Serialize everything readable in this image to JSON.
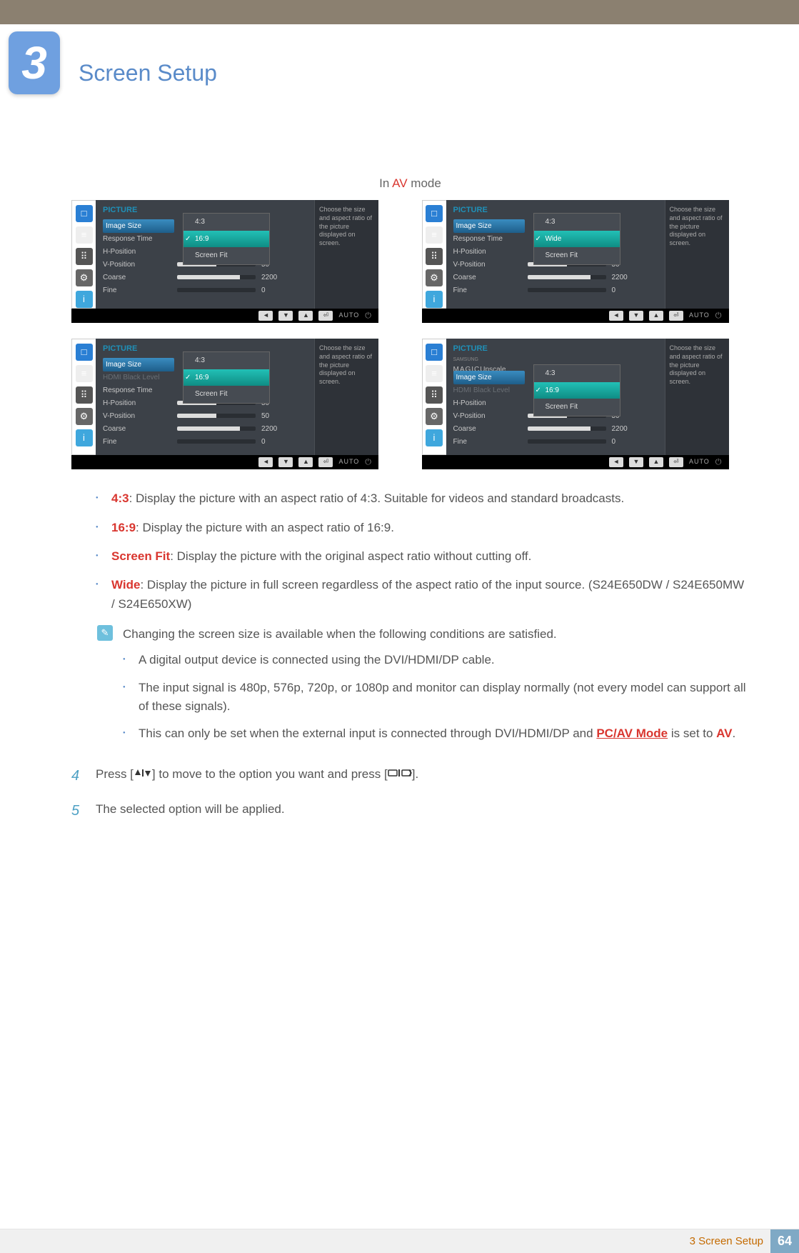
{
  "header": {
    "chapter": "3",
    "title": "Screen Setup"
  },
  "mode_label": {
    "prefix": "In ",
    "highlight": "AV",
    "suffix": " mode"
  },
  "osd": {
    "title": "PICTURE",
    "help": "Choose the size and aspect ratio of the picture displayed on screen.",
    "auto": "AUTO",
    "panels": [
      {
        "rows": [
          {
            "label": "Image Size",
            "selected": true
          },
          {
            "label": "Response Time"
          },
          {
            "label": "H-Position"
          },
          {
            "label": "V-Position",
            "value": "50",
            "fill": 50
          },
          {
            "label": "Coarse",
            "value": "2200",
            "fill": 80
          },
          {
            "label": "Fine",
            "value": "0",
            "fill": 0
          }
        ],
        "options": [
          {
            "label": "4:3"
          },
          {
            "label": "16:9",
            "checked": true,
            "selected": true
          },
          {
            "label": "Screen Fit"
          }
        ]
      },
      {
        "rows": [
          {
            "label": "Image Size",
            "selected": true
          },
          {
            "label": "Response Time"
          },
          {
            "label": "H-Position"
          },
          {
            "label": "V-Position",
            "value": "50",
            "fill": 50
          },
          {
            "label": "Coarse",
            "value": "2200",
            "fill": 80
          },
          {
            "label": "Fine",
            "value": "0",
            "fill": 0
          }
        ],
        "options": [
          {
            "label": "4:3"
          },
          {
            "label": "Wide",
            "checked": true,
            "selected": true
          },
          {
            "label": "Screen Fit"
          }
        ]
      },
      {
        "rows": [
          {
            "label": "Image Size",
            "selected": true
          },
          {
            "label": "HDMI Black Level",
            "dim": true
          },
          {
            "label": "Response Time"
          },
          {
            "label": "H-Position",
            "value": "50",
            "fill": 50
          },
          {
            "label": "V-Position",
            "value": "50",
            "fill": 50
          },
          {
            "label": "Coarse",
            "value": "2200",
            "fill": 80
          },
          {
            "label": "Fine",
            "value": "0",
            "fill": 0
          }
        ],
        "options": [
          {
            "label": "4:3"
          },
          {
            "label": "16:9",
            "checked": true,
            "selected": true
          },
          {
            "label": "Screen Fit"
          }
        ]
      },
      {
        "rows": [
          {
            "label_pre": "SAMSUNG",
            "label_sub": "MAGIC",
            "label": "Upscale"
          },
          {
            "label": "Image Size",
            "selected": true
          },
          {
            "label": "HDMI Black Level",
            "dim": true
          },
          {
            "label": "H-Position"
          },
          {
            "label": "V-Position",
            "value": "50",
            "fill": 50
          },
          {
            "label": "Coarse",
            "value": "2200",
            "fill": 80
          },
          {
            "label": "Fine",
            "value": "0",
            "fill": 0
          }
        ],
        "options": [
          {
            "label": "4:3"
          },
          {
            "label": "16:9",
            "checked": true,
            "selected": true
          },
          {
            "label": "Screen Fit"
          }
        ],
        "opt_offset": true
      }
    ]
  },
  "bullets": [
    {
      "key": "4:3",
      "text": ": Display the picture with an aspect ratio of 4:3. Suitable for videos and standard broadcasts."
    },
    {
      "key": "16:9",
      "text": ": Display the picture with an aspect ratio of 16:9."
    },
    {
      "key": "Screen Fit",
      "text": ": Display the picture with the original aspect ratio without cutting off."
    },
    {
      "key": "Wide",
      "text": ": Display the picture in full screen regardless of the aspect ratio of the input source. (S24E650DW / S24E650MW / S24E650XW)"
    }
  ],
  "note": {
    "intro": "Changing the screen size is available when the following conditions are satisfied.",
    "items": [
      "A digital output device is connected using the DVI/HDMI/DP cable.",
      "The input signal is 480p, 576p, 720p, or 1080p and monitor can display normally (not every model can support all of these signals).",
      {
        "pre": "This can only be set when the external input is connected through DVI/HDMI/DP and ",
        "link": "PC/AV Mode",
        "mid": " is set to ",
        "hl": "AV",
        "post": "."
      }
    ]
  },
  "steps": {
    "s4_pre": "Press [",
    "s4_mid": "] to move to the option you want and press [",
    "s4_post": "].",
    "s5": "The selected option will be applied."
  },
  "footer": {
    "text": "3 Screen Setup",
    "page": "64"
  }
}
